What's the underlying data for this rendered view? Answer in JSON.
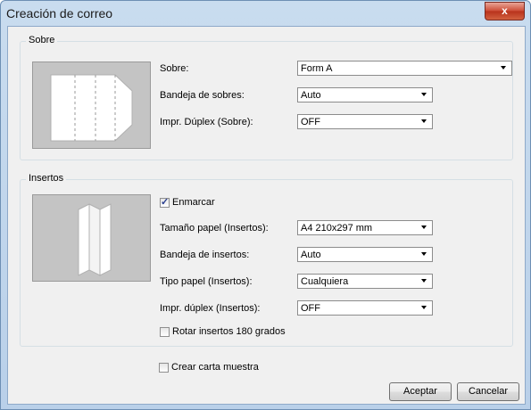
{
  "window": {
    "title": "Creación de correo",
    "close_label": "x"
  },
  "sobre": {
    "group_label": "Sobre",
    "fields": [
      {
        "label": "Sobre:",
        "value": "Form A"
      },
      {
        "label": "Bandeja de sobres:",
        "value": "Auto"
      },
      {
        "label": "Impr. Dúplex (Sobre):",
        "value": "OFF"
      }
    ]
  },
  "insertos": {
    "group_label": "Insertos",
    "enmarcar": {
      "label": "Enmarcar",
      "checked": true
    },
    "fields": [
      {
        "label": "Tamaño papel (Insertos):",
        "value": "A4 210x297 mm"
      },
      {
        "label": "Bandeja de insertos:",
        "value": "Auto"
      },
      {
        "label": "Tipo papel (Insertos):",
        "value": "Cualquiera"
      },
      {
        "label": "Impr. dúplex (Insertos):",
        "value": "OFF"
      }
    ],
    "rotar": {
      "label": "Rotar insertos 180 grados",
      "checked": false
    }
  },
  "crear_carta": {
    "label": "Crear carta muestra",
    "checked": false
  },
  "buttons": {
    "accept": "Aceptar",
    "cancel": "Cancelar"
  }
}
